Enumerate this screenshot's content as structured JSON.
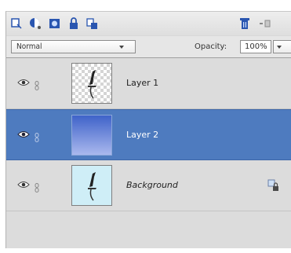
{
  "toolbar": {
    "icons": [
      "new-layer-icon",
      "adjustment-layer-icon",
      "mask-icon",
      "lock-icon",
      "link-layers-icon",
      "trash-icon",
      "more-icon"
    ]
  },
  "options": {
    "blend_mode": "Normal",
    "opacity_label": "Opacity:",
    "opacity_value": "100%"
  },
  "layers": [
    {
      "name": "Layer 1",
      "thumbnail": "bird-on-transparent"
    },
    {
      "name": "Layer 2",
      "thumbnail": "blue-gradient",
      "selected": true
    },
    {
      "name": "Background",
      "thumbnail": "bird-on-sky",
      "locked": true
    }
  ],
  "colors": {
    "selection": "#4e7bbf",
    "panel": "#dcdcdc"
  }
}
